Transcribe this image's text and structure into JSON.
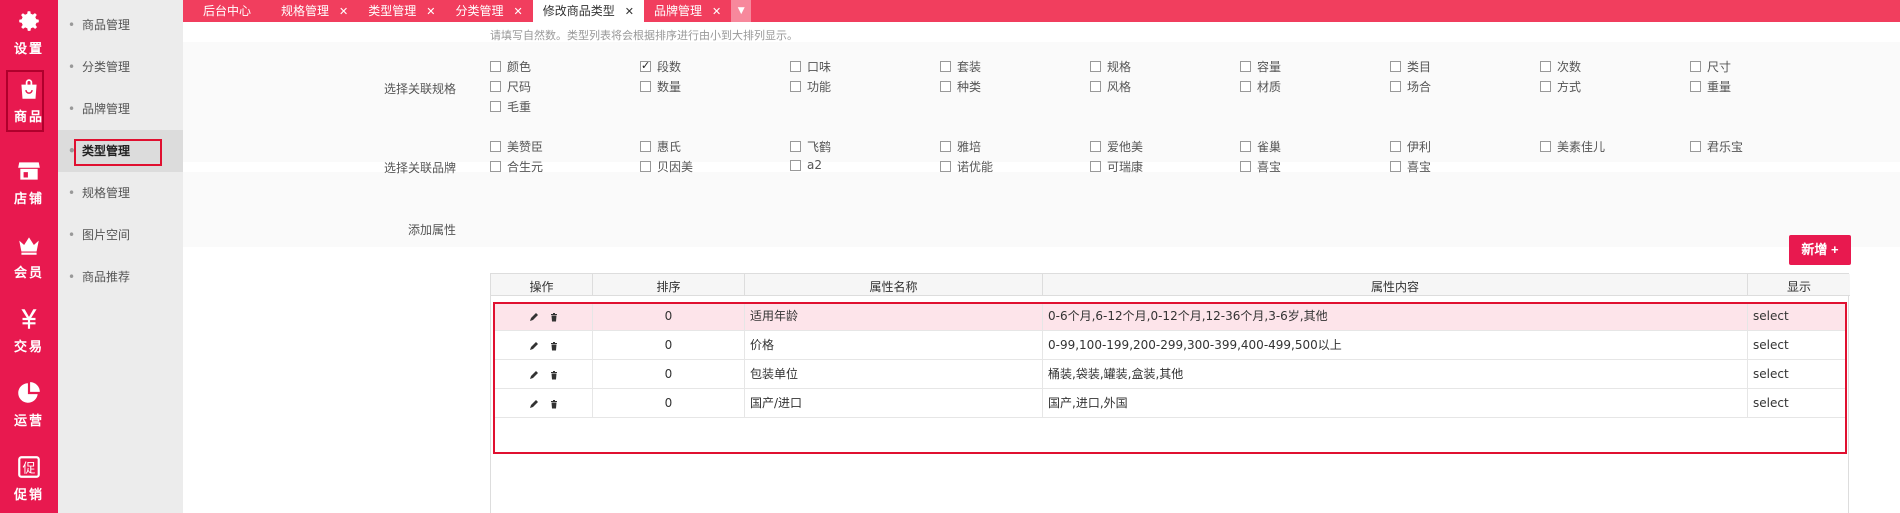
{
  "rail": [
    {
      "label": "设置",
      "icon": "gear-icon"
    },
    {
      "label": "商品",
      "icon": "bag-icon",
      "active": true
    },
    {
      "label": "店铺",
      "icon": "store-icon"
    },
    {
      "label": "会员",
      "icon": "crown-icon"
    },
    {
      "label": "交易",
      "icon": "yen-icon"
    },
    {
      "label": "运营",
      "icon": "pie-icon"
    },
    {
      "label": "促销",
      "icon": "promo-icon"
    }
  ],
  "submenu": [
    {
      "label": "商品管理"
    },
    {
      "label": "分类管理"
    },
    {
      "label": "品牌管理"
    },
    {
      "label": "类型管理",
      "active": true
    },
    {
      "label": "规格管理"
    },
    {
      "label": "图片空间"
    },
    {
      "label": "商品推荐"
    }
  ],
  "tabs": [
    {
      "label": "后台中心",
      "closable": false
    },
    {
      "label": "规格管理",
      "closable": true
    },
    {
      "label": "类型管理",
      "closable": true
    },
    {
      "label": "分类管理",
      "closable": true
    },
    {
      "label": "修改商品类型",
      "closable": true,
      "active": true
    },
    {
      "label": "品牌管理",
      "closable": true
    }
  ],
  "hint": "请填写自然数。类型列表将会根据排序进行由小到大排列显示。",
  "spec_label": "选择关联规格",
  "specs": [
    {
      "label": "颜色",
      "checked": false
    },
    {
      "label": "段数",
      "checked": true
    },
    {
      "label": "口味",
      "checked": false
    },
    {
      "label": "套装",
      "checked": false
    },
    {
      "label": "规格",
      "checked": false
    },
    {
      "label": "容量",
      "checked": false
    },
    {
      "label": "类目",
      "checked": false
    },
    {
      "label": "次数",
      "checked": false
    },
    {
      "label": "尺寸",
      "checked": false
    },
    {
      "label": "尺码",
      "checked": false
    },
    {
      "label": "数量",
      "checked": false
    },
    {
      "label": "功能",
      "checked": false
    },
    {
      "label": "种类",
      "checked": false
    },
    {
      "label": "风格",
      "checked": false
    },
    {
      "label": "材质",
      "checked": false
    },
    {
      "label": "场合",
      "checked": false
    },
    {
      "label": "方式",
      "checked": false
    },
    {
      "label": "重量",
      "checked": false
    },
    {
      "label": "毛重",
      "checked": false
    }
  ],
  "brand_label": "选择关联品牌",
  "brands": [
    {
      "label": "美赞臣",
      "checked": false
    },
    {
      "label": "惠氏",
      "checked": false
    },
    {
      "label": "飞鹤",
      "checked": false
    },
    {
      "label": "雅培",
      "checked": false
    },
    {
      "label": "爱他美",
      "checked": false
    },
    {
      "label": "雀巢",
      "checked": false
    },
    {
      "label": "伊利",
      "checked": false
    },
    {
      "label": "美素佳儿",
      "checked": false
    },
    {
      "label": "君乐宝",
      "checked": false
    },
    {
      "label": "合生元",
      "checked": false
    },
    {
      "label": "贝因美",
      "checked": false
    },
    {
      "label": "a2",
      "checked": false
    },
    {
      "label": "诺优能",
      "checked": false
    },
    {
      "label": "可瑞康",
      "checked": false
    },
    {
      "label": "喜宝",
      "checked": false
    },
    {
      "label": "喜宝",
      "checked": false
    }
  ],
  "attr_label": "添加属性",
  "add_button": "新增 +",
  "table": {
    "headers": [
      "操作",
      "排序",
      "属性名称",
      "属性内容",
      "显示"
    ],
    "rows": [
      {
        "sort": "0",
        "name": "适用年龄",
        "content": "0-6个月,6-12个月,0-12个月,12-36个月,3-6岁,其他",
        "display": "select"
      },
      {
        "sort": "0",
        "name": "价格",
        "content": "0-99,100-199,200-299,300-399,400-499,500以上",
        "display": "select"
      },
      {
        "sort": "0",
        "name": "包装单位",
        "content": "桶装,袋装,罐装,盒装,其他",
        "display": "select"
      },
      {
        "sort": "0",
        "name": "国产/进口",
        "content": "国产,进口,外国",
        "display": "select"
      }
    ]
  },
  "colors": {
    "brand": "#e8194f",
    "tab_bar": "#f13e5e",
    "highlight_row": "#fde4ea",
    "frame": "#e01030"
  }
}
